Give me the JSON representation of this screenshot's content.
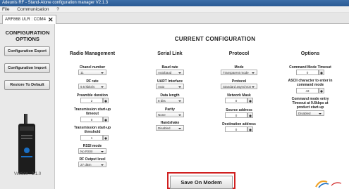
{
  "window": {
    "title": "Adeunis RF - Stand-Alone configuration manager V2.1.3"
  },
  "menu": [
    "File",
    "Communication",
    "?"
  ],
  "tab": {
    "label": "ARF868 ULR : COM4"
  },
  "sidebar": {
    "title_line1": "CONFIGURATION",
    "title_line2": "OPTIONS",
    "buttons": [
      "Configuration Export",
      "Configuration Import",
      "Restore To Default"
    ],
    "version": "Version : 2.1.0"
  },
  "main": {
    "title": "CURRENT CONFIGURATION"
  },
  "columns": {
    "radio": {
      "header": "Radio Management",
      "channel_number": {
        "label": "Chanel number",
        "value": "11"
      },
      "rf_rate": {
        "label": "RF rate",
        "value": "9.6 kbits/s"
      },
      "preamble": {
        "label": "Preamble duration",
        "value": "2"
      },
      "tx_startup": {
        "label1": "Transmission start-up",
        "label2": "timeout",
        "value": "0"
      },
      "tx_threshold": {
        "label1": "Transmission start-up",
        "label2": "threshold",
        "value": "1"
      },
      "rssi_mode": {
        "label": "RSSI mode",
        "value": "No RSSI"
      },
      "rf_output": {
        "label": "RF Output level",
        "value": "27 dBm"
      }
    },
    "serial": {
      "header": "Serial Link",
      "baud_rate": {
        "label": "Baud rate",
        "value": "Autobaud"
      },
      "uart": {
        "label": "UART Interface",
        "value": "Auto"
      },
      "data_length": {
        "label": "Data length",
        "value": "8 bits"
      },
      "parity": {
        "label": "Parity",
        "value": "None"
      },
      "handshake": {
        "label": "Handshake",
        "value": "Disabled"
      }
    },
    "protocol": {
      "header": "Protocol",
      "mode": {
        "label": "Mode",
        "value": "Transparent mode"
      },
      "protocol": {
        "label": "Protocol",
        "value": "Standard asynchron"
      },
      "network_mask": {
        "label": "Network Mask",
        "value": "0"
      },
      "source_address": {
        "label": "Source address",
        "value": "0"
      },
      "dest_address": {
        "label": "Destination address",
        "value": "0"
      }
    },
    "options": {
      "header": "Options",
      "cmd_timeout": {
        "label": "Command Mode Timeout",
        "value": "0"
      },
      "ascii_char": {
        "label1": "ASCII character to enter in",
        "label2": "command mode",
        "value": "43"
      },
      "cmd_entry": {
        "label1": "Command mode entry",
        "label2": "Timeout at 9.6kbps at",
        "label3": "product start-up",
        "value": "Disabled"
      }
    }
  },
  "save_button": "Save On Modem",
  "colors": {
    "titlebar": "#2a5a94",
    "highlight": "#d02020",
    "sidebar": "#e9e9e9"
  }
}
